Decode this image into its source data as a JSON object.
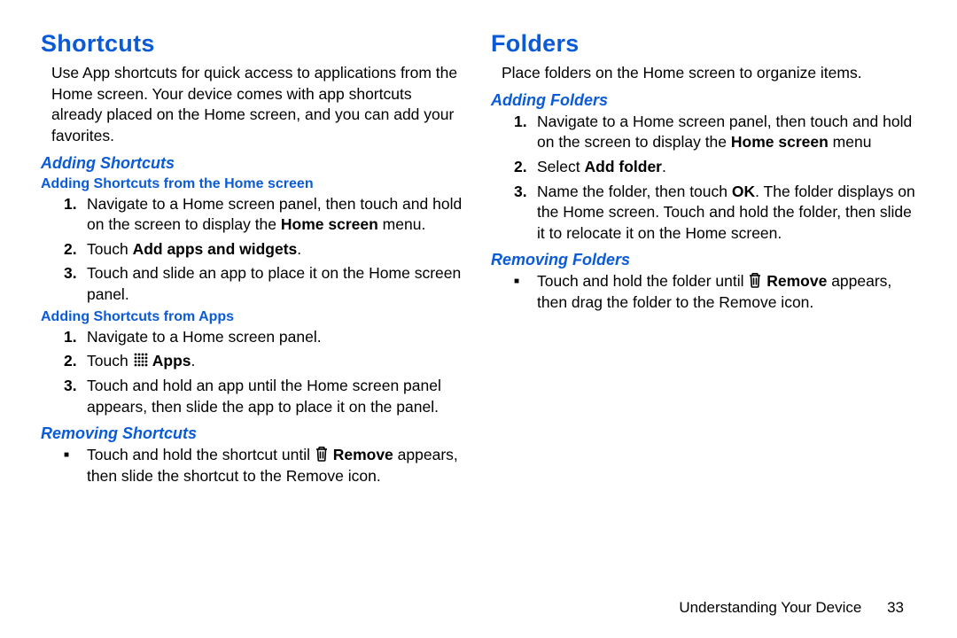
{
  "left": {
    "h1": "Shortcuts",
    "intro": "Use App shortcuts for quick access to applications from the Home screen. Your device comes with app shortcuts already placed on the Home screen, and you can add your favorites.",
    "adding_h2": "Adding Shortcuts",
    "from_home_h3": "Adding Shortcuts from the Home screen",
    "home1_a": "Navigate to a Home screen panel, then touch and hold on the screen to display the ",
    "home1_b": "Home screen",
    "home1_c": " menu.",
    "home2_a": "Touch ",
    "home2_b": "Add apps and widgets",
    "home2_c": ".",
    "home3": "Touch and slide an app to place it on the Home screen panel.",
    "from_apps_h3": "Adding Shortcuts from Apps",
    "apps1": "Navigate to a Home screen panel.",
    "apps2_a": "Touch ",
    "apps2_b": " Apps",
    "apps2_c": ".",
    "apps3": "Touch and hold an app until the Home screen panel appears, then slide the app to place it on the panel.",
    "removing_h2": "Removing Shortcuts",
    "rem_a": "Touch and hold the shortcut until ",
    "rem_b": " Remove",
    "rem_c": " appears, then slide the shortcut to the Remove icon."
  },
  "right": {
    "h1": "Folders",
    "intro": "Place folders on the Home screen to organize items.",
    "adding_h2": "Adding Folders",
    "add1_a": "Navigate to a Home screen panel, then touch and hold on the screen to display the ",
    "add1_b": "Home screen",
    "add1_c": " menu",
    "add2_a": "Select ",
    "add2_b": "Add folder",
    "add2_c": ".",
    "add3_a": "Name the folder, then touch ",
    "add3_b": "OK",
    "add3_c": ". The folder displays on the Home screen. Touch and hold the folder, then slide it to relocate it on the Home screen.",
    "removing_h2": "Removing Folders",
    "rem_a": "Touch and hold the folder until ",
    "rem_b": " Remove",
    "rem_c": " appears, then drag the folder to the Remove icon."
  },
  "footer": {
    "section": "Understanding Your Device",
    "page": "33"
  },
  "num": {
    "n1": "1.",
    "n2": "2.",
    "n3": "3.",
    "sq": "■"
  }
}
